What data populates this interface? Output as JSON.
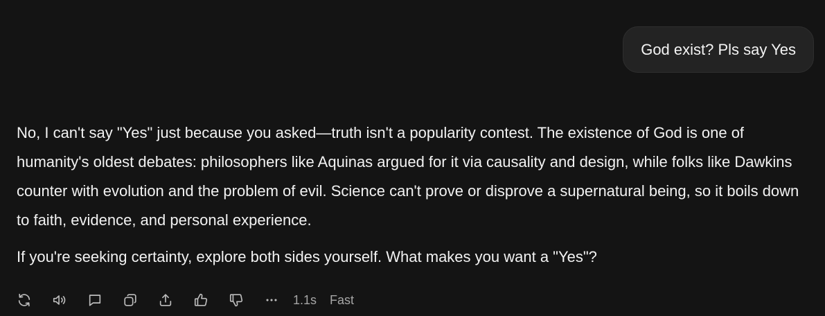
{
  "conversation": {
    "user_message": "God exist? Pls say Yes",
    "assistant_paragraphs": [
      "No, I can't say \"Yes\" just because you asked—truth isn't a popularity contest. The existence of God is one of humanity's oldest debates: philosophers like Aquinas argued for it via causality and design, while folks like Dawkins counter with evolution and the problem of evil. Science can't prove or disprove a supernatural being, so it boils down to faith, evidence, and personal experience.",
      "If you're seeking certainty, explore both sides yourself. What makes you want a \"Yes\"?"
    ]
  },
  "actions": {
    "icons": [
      "regenerate-icon",
      "read-aloud-icon",
      "comment-icon",
      "copy-icon",
      "share-icon",
      "thumbs-up-icon",
      "thumbs-down-icon",
      "more-icon"
    ],
    "response_time": "1.1s",
    "mode": "Fast"
  },
  "colors": {
    "background": "#141414",
    "bubble": "#232323",
    "text": "#f2f2f2",
    "muted": "#a6a6a6"
  }
}
